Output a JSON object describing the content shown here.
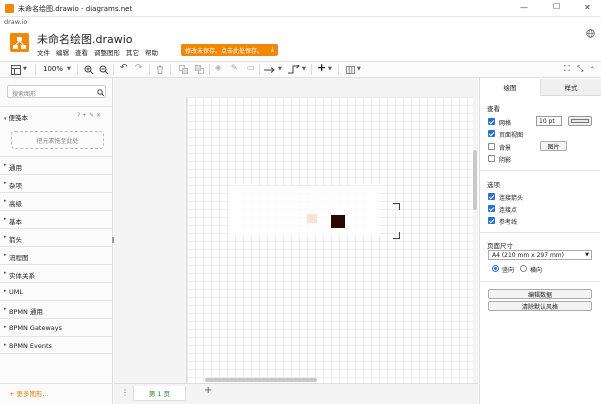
{
  "window": {
    "title": "未命名绘图.drawio - diagrams.net",
    "subtitle": "draw.io",
    "minimize": "—",
    "maximize": "☐",
    "close": "✕"
  },
  "app": {
    "name": "未命名绘图.drawio",
    "menu": [
      "文件",
      "编辑",
      "查看",
      "调整图形",
      "其它",
      "帮助"
    ],
    "save_banner": "修改未保存。点击此处保存。"
  },
  "toolbar": {
    "zoom": "100%"
  },
  "left": {
    "search_placeholder": "搜索图形",
    "scratchpad": "便笺本",
    "scratchpad_actions": "? + ✎ ✕",
    "dropzone": "把元素拖至此处",
    "libraries": [
      "通用",
      "杂项",
      "高级",
      "基本",
      "箭头",
      "流程图",
      "实体关系",
      "UML",
      "BPMN 通用",
      "BPMN Gateways",
      "BPMN Events"
    ],
    "more_shapes": "+ 更多图形..."
  },
  "pages": {
    "current": "第 1 页",
    "add": "+",
    "menu": "⋮"
  },
  "right": {
    "tabs": [
      "绘图",
      "样式"
    ],
    "view_section": "查看",
    "grid": "网格",
    "grid_size": "10 pt",
    "grid_checked": true,
    "page_view": "页面视图",
    "page_view_checked": true,
    "background": "背景",
    "background_checked": false,
    "background_button": "图片",
    "shadow": "阴影",
    "shadow_checked": false,
    "options_section": "选项",
    "connection_arrows": "连接箭头",
    "connection_arrows_checked": true,
    "connection_points": "连接点",
    "connection_points_checked": true,
    "guides": "参考线",
    "guides_checked": true,
    "paper_section": "页面尺寸",
    "paper_size": "A4 (210 mm x 297 mm)",
    "portrait": "竖向",
    "landscape": "横向",
    "portrait_selected": true,
    "edit_data": "编辑数据",
    "clear_style": "清除默认风格"
  },
  "colors": {
    "accent": "#f08705",
    "check": "#2a6fd6",
    "tab_text": "#2e7d32"
  }
}
